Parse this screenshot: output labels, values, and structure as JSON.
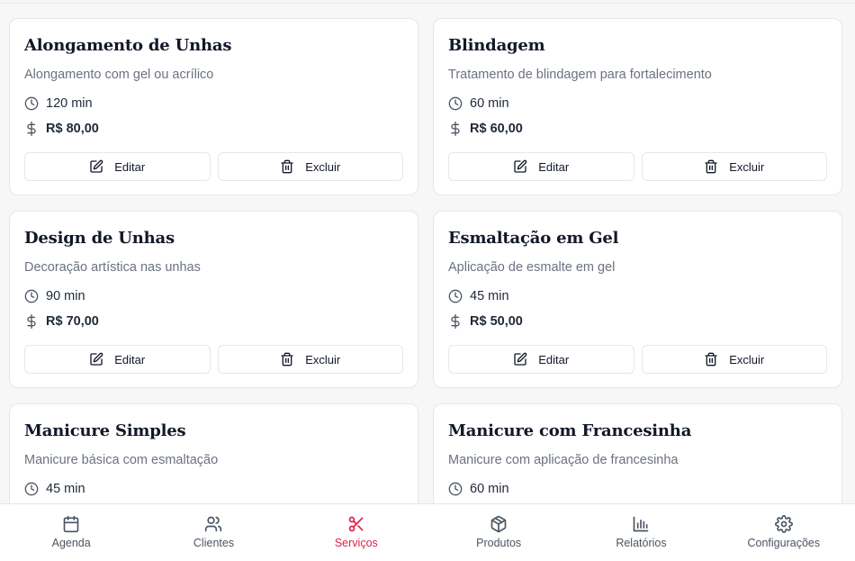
{
  "services": [
    {
      "title": "Alongamento de Unhas",
      "description": "Alongamento com gel ou acrílico",
      "duration": "120 min",
      "price": "R$ 80,00"
    },
    {
      "title": "Blindagem",
      "description": "Tratamento de blindagem para fortalecimento",
      "duration": "60 min",
      "price": "R$ 60,00"
    },
    {
      "title": "Design de Unhas",
      "description": "Decoração artística nas unhas",
      "duration": "90 min",
      "price": "R$ 70,00"
    },
    {
      "title": "Esmaltação em Gel",
      "description": "Aplicação de esmalte em gel",
      "duration": "45 min",
      "price": "R$ 50,00"
    },
    {
      "title": "Manicure Simples",
      "description": "Manicure básica com esmaltação",
      "duration": "45 min",
      "price": ""
    },
    {
      "title": "Manicure com Francesinha",
      "description": "Manicure com aplicação de francesinha",
      "duration": "60 min",
      "price": ""
    }
  ],
  "buttons": {
    "edit_label": "Editar",
    "delete_label": "Excluir"
  },
  "nav": {
    "items": [
      {
        "label": "Agenda",
        "icon": "calendar-icon"
      },
      {
        "label": "Clientes",
        "icon": "users-icon"
      },
      {
        "label": "Serviços",
        "icon": "scissors-icon",
        "active": true
      },
      {
        "label": "Produtos",
        "icon": "package-icon"
      },
      {
        "label": "Relatórios",
        "icon": "bar-chart-icon"
      },
      {
        "label": "Configurações",
        "icon": "gear-icon"
      }
    ]
  },
  "colors": {
    "accent": "#e11d48",
    "muted_text": "#6b7280",
    "border": "#e5e7eb"
  }
}
